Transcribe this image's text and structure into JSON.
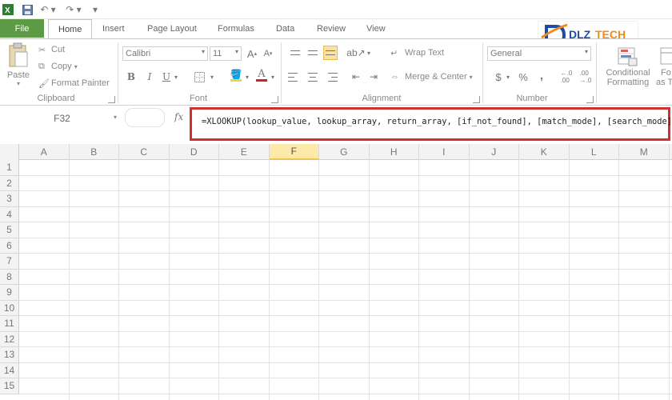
{
  "qat": {
    "icons": [
      "excel-icon",
      "save-icon",
      "undo-icon",
      "redo-icon",
      "customize-icon"
    ]
  },
  "tabs": {
    "file": "File",
    "home": "Home",
    "insert": "Insert",
    "page_layout": "Page Layout",
    "formulas": "Formulas",
    "data": "Data",
    "review": "Review",
    "view": "View"
  },
  "logo": {
    "text": "DLZ TECH"
  },
  "clipboard": {
    "paste": "Paste",
    "cut": "Cut",
    "copy": "Copy",
    "format_painter": "Format Painter",
    "label": "Clipboard"
  },
  "font": {
    "name": "Calibri",
    "size": "11",
    "bold": "B",
    "italic": "I",
    "underline": "U",
    "label": "Font"
  },
  "alignment": {
    "wrap_text": "Wrap Text",
    "merge_center": "Merge & Center",
    "label": "Alignment"
  },
  "number": {
    "format": "General",
    "currency": "$",
    "percent": "%",
    "comma": ",",
    "label": "Number"
  },
  "styles": {
    "conditional_1": "Conditional",
    "conditional_2": "Formatting",
    "format_as_1": "Fo",
    "format_as_2": "as T"
  },
  "formula_bar": {
    "name_box": "F32",
    "fx": "fx",
    "formula": "=XLOOKUP(lookup_value, lookup_array, return_array, [if_not_found], [match_mode], [search_mode])"
  },
  "grid": {
    "columns": [
      "A",
      "B",
      "C",
      "D",
      "E",
      "F",
      "G",
      "H",
      "I",
      "J",
      "K",
      "L",
      "M"
    ],
    "rows": [
      "1",
      "2",
      "3",
      "4",
      "5",
      "6",
      "7",
      "8",
      "9",
      "10",
      "11",
      "12",
      "13",
      "14",
      "15"
    ],
    "selected_column": "F",
    "accent_color": "#d03030",
    "file_tab_color": "#5c9a46"
  }
}
